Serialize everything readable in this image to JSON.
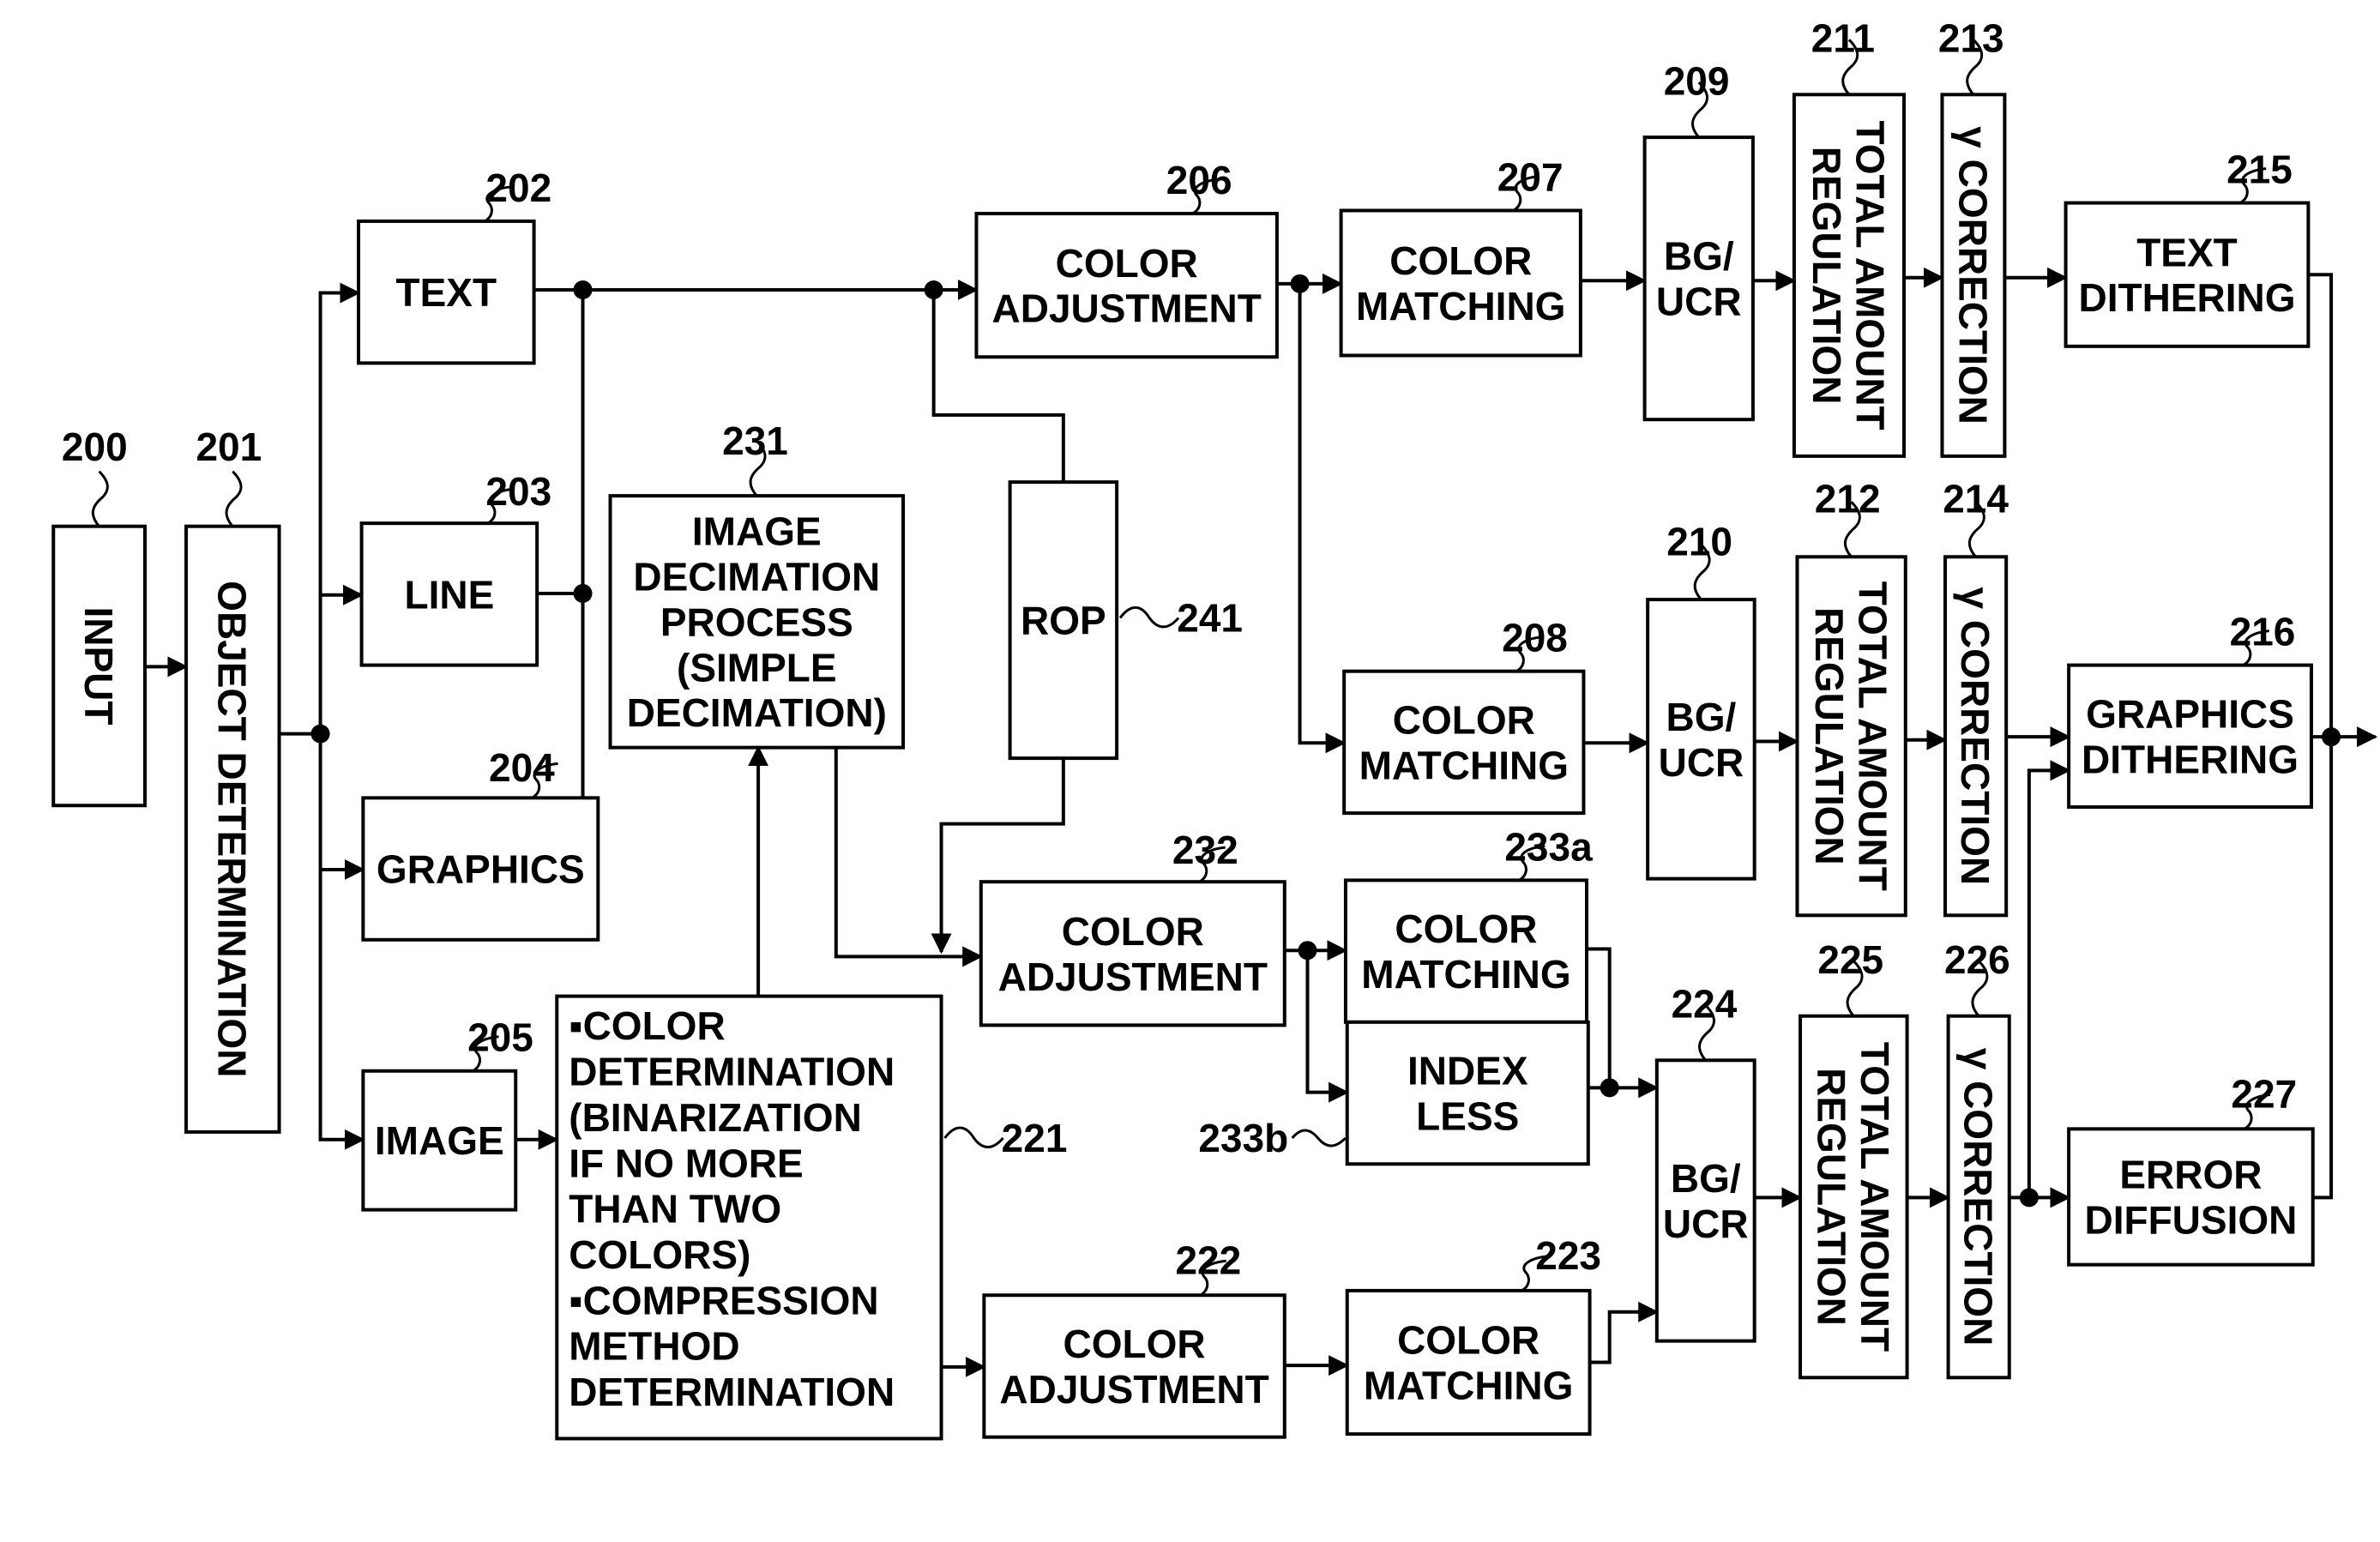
{
  "diagram": {
    "type": "block-diagram",
    "blocks": {
      "b200": {
        "ref": "200",
        "lines": [
          "INPUT"
        ]
      },
      "b201": {
        "ref": "201",
        "lines": [
          "OBJECT DETERMINATION"
        ]
      },
      "b202": {
        "ref": "202",
        "lines": [
          "TEXT"
        ]
      },
      "b203": {
        "ref": "203",
        "lines": [
          "LINE"
        ]
      },
      "b204": {
        "ref": "204",
        "lines": [
          "GRAPHICS"
        ]
      },
      "b205": {
        "ref": "205",
        "lines": [
          "IMAGE"
        ]
      },
      "b206": {
        "ref": "206",
        "lines": [
          "COLOR",
          "ADJUSTMENT"
        ]
      },
      "b207": {
        "ref": "207",
        "lines": [
          "COLOR",
          "MATCHING"
        ]
      },
      "b208": {
        "ref": "208",
        "lines": [
          "COLOR",
          "MATCHING"
        ]
      },
      "b209": {
        "ref": "209",
        "lines": [
          "BG/",
          "UCR"
        ]
      },
      "b210": {
        "ref": "210",
        "lines": [
          "BG/",
          "UCR"
        ]
      },
      "b211": {
        "ref": "211",
        "lines": [
          "TOTAL AMOUNT",
          "REGULATION"
        ]
      },
      "b212": {
        "ref": "212",
        "lines": [
          "TOTAL AMOUNT",
          "REGULATION"
        ]
      },
      "b213": {
        "ref": "213",
        "lines": [
          "γ CORRECTION"
        ]
      },
      "b214": {
        "ref": "214",
        "lines": [
          "γ CORRECTION"
        ]
      },
      "b215": {
        "ref": "215",
        "lines": [
          "TEXT",
          "DITHERING"
        ]
      },
      "b216": {
        "ref": "216",
        "lines": [
          "GRAPHICS",
          "DITHERING"
        ]
      },
      "b221": {
        "ref": "221",
        "lines": [
          "▪COLOR",
          " DETERMINATION",
          " (BINARIZATION",
          " IF NO MORE",
          " THAN TWO",
          " COLORS)",
          "▪COMPRESSION",
          " METHOD",
          " DETERMINATION"
        ]
      },
      "b222": {
        "ref": "222",
        "lines": [
          "COLOR",
          "ADJUSTMENT"
        ]
      },
      "b223": {
        "ref": "223",
        "lines": [
          "COLOR",
          "MATCHING"
        ]
      },
      "b224": {
        "ref": "224",
        "lines": [
          "BG/",
          "UCR"
        ]
      },
      "b225": {
        "ref": "225",
        "lines": [
          "TOTAL AMOUNT",
          "REGULATION"
        ]
      },
      "b226": {
        "ref": "226",
        "lines": [
          "γ CORRECTION"
        ]
      },
      "b227": {
        "ref": "227",
        "lines": [
          "ERROR",
          "DIFFUSION"
        ]
      },
      "b231": {
        "ref": "231",
        "lines": [
          "IMAGE",
          "DECIMATION",
          "PROCESS",
          "(SIMPLE",
          "DECIMATION)"
        ]
      },
      "b232": {
        "ref": "232",
        "lines": [
          "COLOR",
          "ADJUSTMENT"
        ]
      },
      "b233a": {
        "ref": "233a",
        "lines": [
          "COLOR",
          "MATCHING"
        ]
      },
      "b233b": {
        "ref": "233b",
        "lines": [
          "INDEX",
          "LESS"
        ]
      },
      "b241": {
        "ref": "241",
        "lines": [
          "ROP"
        ]
      }
    }
  }
}
